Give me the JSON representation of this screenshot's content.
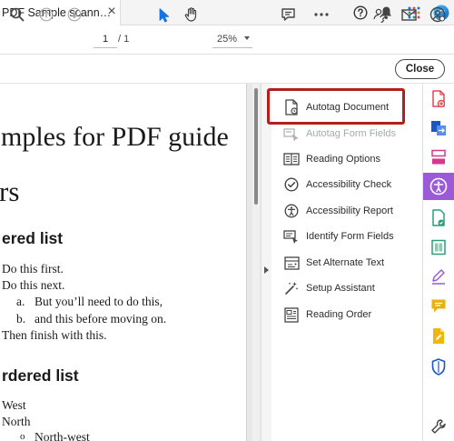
{
  "tab": {
    "title": "PDF Sample scann…",
    "close_glyph": "×"
  },
  "toolbar": {
    "page_current": "1",
    "page_total": "/  1",
    "zoom": "25%"
  },
  "close_label": "Close",
  "document": {
    "title": "mples for PDF guide",
    "heading_large": "rs",
    "section1": "ered list",
    "items1": [
      "Do this first.",
      "Do this next.",
      "Then finish with this."
    ],
    "sub_labels": [
      "a.",
      "b."
    ],
    "sub_items": [
      "But you’ll need to do this,",
      "and this before moving on."
    ],
    "section2": "rdered list",
    "items2": [
      "West",
      "North",
      "North-west"
    ]
  },
  "tools": [
    {
      "label": "Autotag Document",
      "icon": "autotag-document-icon",
      "disabled": false
    },
    {
      "label": "Autotag Form Fields",
      "icon": "autotag-form-fields-icon",
      "disabled": true
    },
    {
      "label": "Reading Options",
      "icon": "reading-options-icon",
      "disabled": false
    },
    {
      "label": "Accessibility Check",
      "icon": "accessibility-check-icon",
      "disabled": false
    },
    {
      "label": "Accessibility Report",
      "icon": "accessibility-report-icon",
      "disabled": false
    },
    {
      "label": "Identify Form Fields",
      "icon": "identify-form-fields-icon",
      "disabled": false
    },
    {
      "label": "Set Alternate Text",
      "icon": "set-alternate-text-icon",
      "disabled": false
    },
    {
      "label": "Setup Assistant",
      "icon": "setup-assistant-icon",
      "disabled": false
    },
    {
      "label": "Reading Order",
      "icon": "reading-order-icon",
      "disabled": false
    }
  ],
  "colors": {
    "highlight": "#b3201c",
    "accent_active": "#9b5bd6",
    "select_tool": "#1473e6"
  }
}
